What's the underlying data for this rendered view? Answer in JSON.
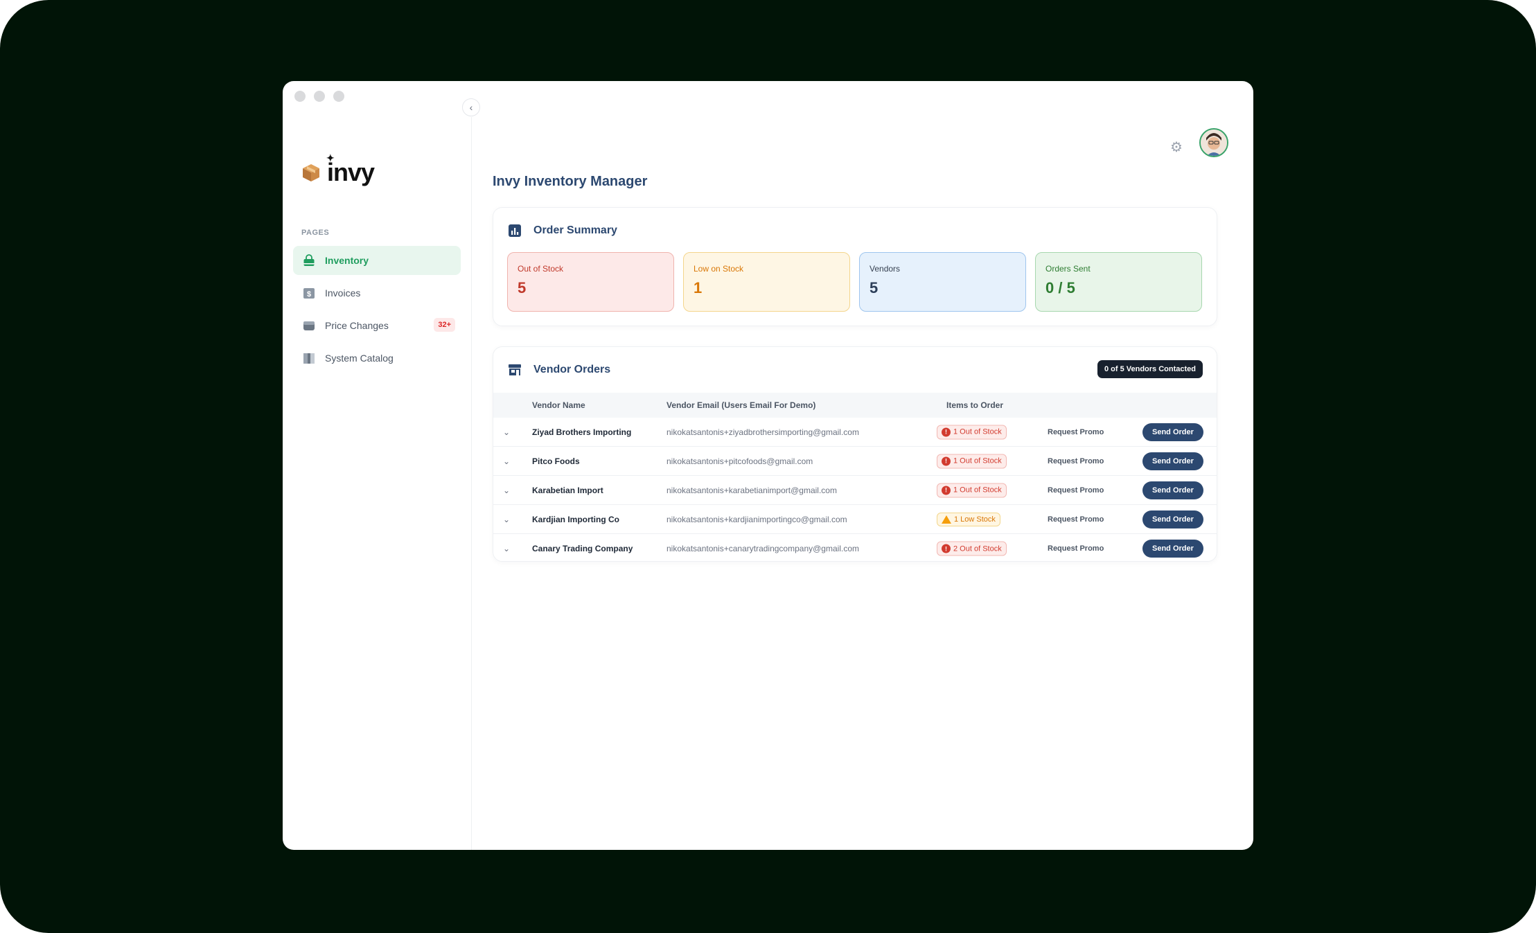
{
  "app": {
    "brand": "invy",
    "page_title": "Invy Inventory Manager"
  },
  "sidebar": {
    "section_label": "PAGES",
    "items": [
      {
        "label": "Inventory",
        "icon": "inventory-bag-icon",
        "active": true
      },
      {
        "label": "Invoices",
        "icon": "invoice-dollar-icon"
      },
      {
        "label": "Price Changes",
        "icon": "price-box-icon",
        "badge": "32+"
      },
      {
        "label": "System Catalog",
        "icon": "catalog-book-icon"
      }
    ]
  },
  "summary": {
    "title": "Order Summary",
    "stats": [
      {
        "label": "Out of Stock",
        "value": "5"
      },
      {
        "label": "Low on Stock",
        "value": "1"
      },
      {
        "label": "Vendors",
        "value": "5"
      },
      {
        "label": "Orders Sent",
        "value": "0 / 5"
      }
    ]
  },
  "orders": {
    "title": "Vendor Orders",
    "contacted_badge": "0 of 5 Vendors Contacted",
    "columns": [
      "Vendor Name",
      "Vendor Email (Users Email For Demo)",
      "Items to Order"
    ],
    "rows": [
      {
        "name": "Ziyad Brothers Importing",
        "email": "nikokatsantonis+ziyadbrothersimporting@gmail.com",
        "status": "1 Out of Stock",
        "kind": "out",
        "promo": "Request Promo",
        "action": "Send Order"
      },
      {
        "name": "Pitco Foods",
        "email": "nikokatsantonis+pitcofoods@gmail.com",
        "status": "1 Out of Stock",
        "kind": "out",
        "promo": "Request Promo",
        "action": "Send Order"
      },
      {
        "name": "Karabetian Import",
        "email": "nikokatsantonis+karabetianimport@gmail.com",
        "status": "1 Out of Stock",
        "kind": "out",
        "promo": "Request Promo",
        "action": "Send Order"
      },
      {
        "name": "Kardjian Importing Co",
        "email": "nikokatsantonis+kardjianimportingco@gmail.com",
        "status": "1 Low Stock",
        "kind": "low",
        "promo": "Request Promo",
        "action": "Send Order"
      },
      {
        "name": "Canary Trading Company",
        "email": "nikokatsantonis+canarytradingcompany@gmail.com",
        "status": "2 Out of Stock",
        "kind": "out",
        "promo": "Request Promo",
        "action": "Send Order"
      }
    ]
  },
  "colors": {
    "brand_green": "#1f9d5e",
    "navy": "#2c4870",
    "stage_bg": "#011407"
  }
}
